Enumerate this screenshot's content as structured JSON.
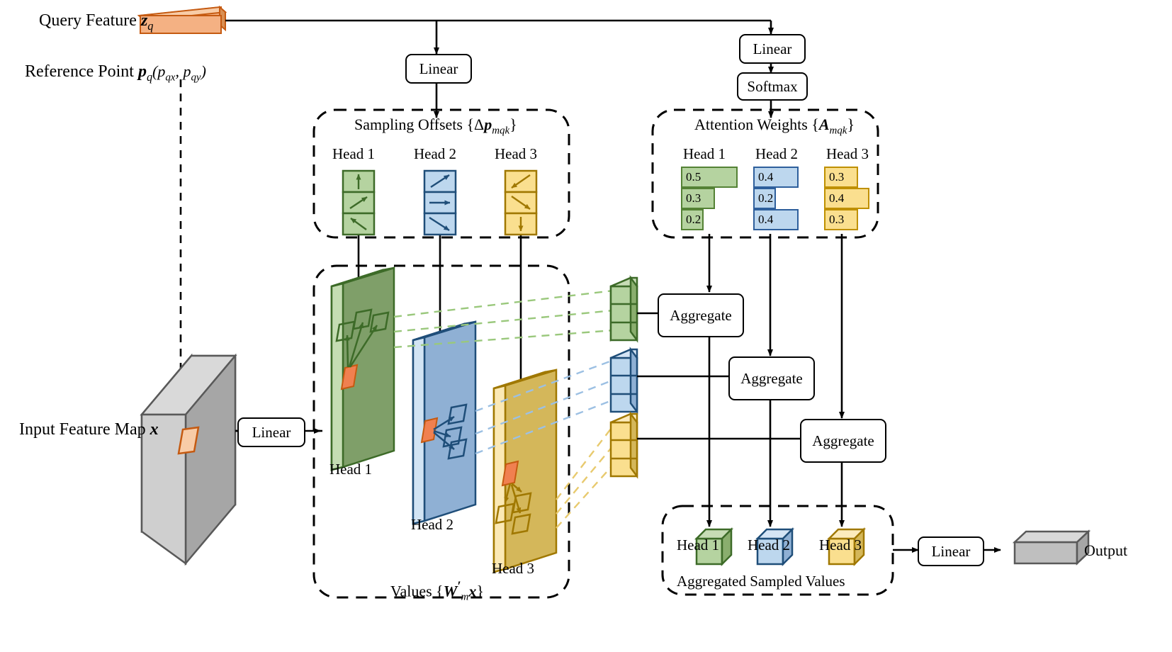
{
  "title": "Deformable Attention Module",
  "labels": {
    "query_feature": "Query Feature",
    "query_feature_sym": "z",
    "query_feature_sub": "q",
    "reference_point": "Reference Point",
    "reference_point_sym": "p",
    "reference_point_sub": "q",
    "reference_point_coords": "(p_qx, p_qy)",
    "input_feature_map": "Input Feature Map",
    "input_feature_map_sym": "x",
    "output": "Output"
  },
  "boxes": {
    "linear_left": "Linear",
    "linear_right": "Linear",
    "softmax": "Softmax",
    "linear_input": "Linear",
    "linear_output": "Linear",
    "aggregate_1": "Aggregate",
    "aggregate_2": "Aggregate",
    "aggregate_3": "Aggregate"
  },
  "groups": {
    "sampling_offsets": {
      "title": "Sampling Offsets {Δp_mqk}",
      "title_main": "Sampling Offsets {Δ",
      "title_sym": "p",
      "title_sub": "mqk",
      "title_end": "}",
      "heads": [
        {
          "label": "Head 1",
          "color": "#b5d3a0",
          "border": "#548235",
          "arrows": [
            "up",
            "up-right",
            "up-left"
          ]
        },
        {
          "label": "Head 2",
          "color": "#bdd7ee",
          "border": "#2e5f9c",
          "arrows": [
            "up-right",
            "right",
            "down-right"
          ]
        },
        {
          "label": "Head 3",
          "color": "#fadf8f",
          "border": "#bf9000",
          "arrows": [
            "down-left",
            "down-right",
            "down"
          ]
        }
      ]
    },
    "attention_weights": {
      "title": "Attention Weights {A_mqk}",
      "title_main": "Attention Weights {",
      "title_sym": "A",
      "title_sub": "mqk",
      "title_end": "}",
      "heads": [
        {
          "label": "Head 1",
          "color": "#b5d3a0",
          "border": "#548235",
          "values": [
            0.5,
            0.3,
            0.2
          ],
          "value_labels": [
            "0.5",
            "0.3",
            "0.2"
          ]
        },
        {
          "label": "Head 2",
          "color": "#bdd7ee",
          "border": "#2e5f9c",
          "values": [
            0.4,
            0.2,
            0.4
          ],
          "value_labels": [
            "0.4",
            "0.2",
            "0.4"
          ]
        },
        {
          "label": "Head 3",
          "color": "#fadf8f",
          "border": "#bf9000",
          "values": [
            0.3,
            0.4,
            0.3
          ],
          "value_labels": [
            "0.3",
            "0.4",
            "0.3"
          ]
        }
      ]
    },
    "values": {
      "title": "Values {W'_m x}",
      "title_main": "Values {",
      "title_sym": "W",
      "title_prime": "′",
      "title_sub": "m",
      "title_sym2": "x",
      "title_end": "}",
      "heads": [
        {
          "label": "Head 1",
          "color": "#8fad78",
          "border": "#548235",
          "side": "#b5d3a0"
        },
        {
          "label": "Head 2",
          "color": "#8fb0d4",
          "border": "#2e5f9c",
          "side": "#bdd7ee"
        },
        {
          "label": "Head 3",
          "color": "#d4b75a",
          "border": "#bf9000",
          "side": "#fadf8f"
        }
      ]
    },
    "aggregated": {
      "title": "Aggregated Sampled Values",
      "heads": [
        {
          "label": "Head 1",
          "color": "#b5d3a0",
          "border": "#548235"
        },
        {
          "label": "Head 2",
          "color": "#bdd7ee",
          "border": "#2e5f9c"
        },
        {
          "label": "Head 3",
          "color": "#fadf8f",
          "border": "#bf9000"
        }
      ]
    }
  },
  "colors": {
    "green_fill": "#b5d3a0",
    "green_border": "#548235",
    "blue_fill": "#bdd7ee",
    "blue_border": "#2e5f9c",
    "yellow_fill": "#fadf8f",
    "yellow_border": "#bf9000",
    "orange_fill": "#f4b183",
    "orange_border": "#c55a11",
    "gray_fill": "#bfbfbf",
    "gray_dark": "#a6a6a6",
    "gray_border": "#595959",
    "line": "#000000"
  }
}
